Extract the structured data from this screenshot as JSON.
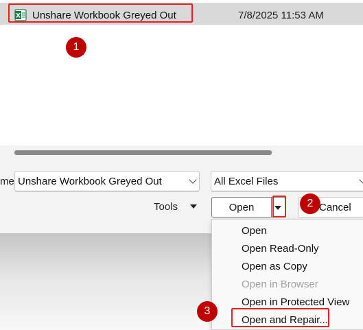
{
  "file_list": {
    "row": {
      "name": "Unshare Workbook Greyed Out",
      "date_modified": "7/8/2025 11:53 AM",
      "icon": "excel-file-icon"
    }
  },
  "footer": {
    "file_name_label": "me:",
    "file_name_value": "Unshare Workbook Greyed Out",
    "file_type": "All Excel Files",
    "tools_label": "Tools",
    "open_label": "Open",
    "cancel_label": "Cancel"
  },
  "open_menu": {
    "items": [
      {
        "label": "Open",
        "enabled": true
      },
      {
        "label": "Open Read-Only",
        "enabled": true
      },
      {
        "label": "Open as Copy",
        "enabled": true
      },
      {
        "label": "Open in Browser",
        "enabled": false
      },
      {
        "label": "Open in Protected View",
        "enabled": true
      },
      {
        "label": "Open and Repair...",
        "enabled": true
      }
    ]
  },
  "annotations": {
    "badges": [
      "1",
      "2",
      "3"
    ],
    "highlight_color": "#e02424",
    "badge_color": "#c00000"
  }
}
